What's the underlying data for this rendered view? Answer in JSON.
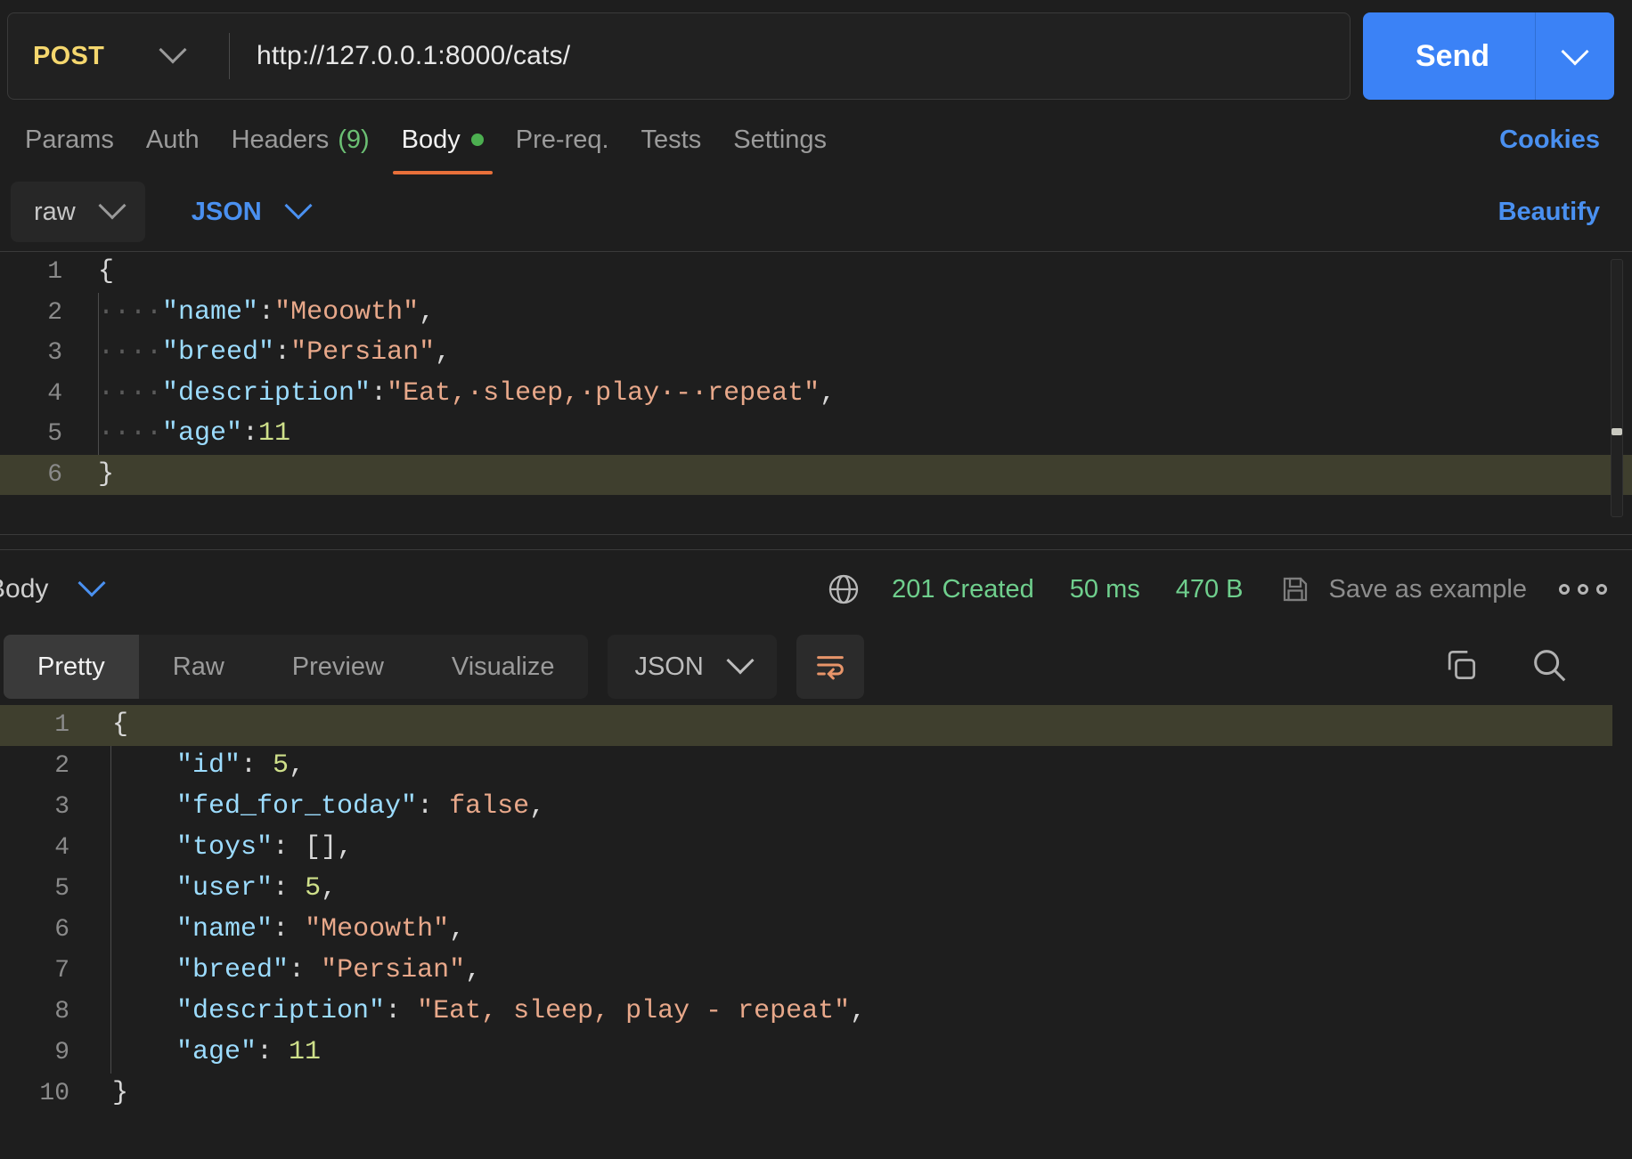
{
  "request": {
    "method": "POST",
    "url": "http://127.0.0.1:8000/cats/",
    "send_label": "Send",
    "tabs": [
      {
        "label": "Params",
        "active": false
      },
      {
        "label": "Auth",
        "active": false
      },
      {
        "label": "Headers",
        "count": "(9)",
        "active": false
      },
      {
        "label": "Body",
        "active": true,
        "dot": true
      },
      {
        "label": "Pre-req.",
        "active": false
      },
      {
        "label": "Tests",
        "active": false
      },
      {
        "label": "Settings",
        "active": false
      }
    ],
    "cookies_label": "Cookies",
    "body_mode": "raw",
    "body_format": "JSON",
    "beautify_label": "Beautify",
    "code_lines": [
      {
        "num": "1",
        "highlight": false,
        "indent": false,
        "tokens": [
          {
            "t": "{",
            "c": "p"
          }
        ]
      },
      {
        "num": "2",
        "highlight": false,
        "indent": true,
        "tokens": [
          {
            "t": "····",
            "c": "dot"
          },
          {
            "t": "\"name\"",
            "c": "k"
          },
          {
            "t": ":",
            "c": "p"
          },
          {
            "t": "\"Meoowth\"",
            "c": "s"
          },
          {
            "t": ",",
            "c": "p"
          }
        ]
      },
      {
        "num": "3",
        "highlight": false,
        "indent": true,
        "tokens": [
          {
            "t": "····",
            "c": "dot"
          },
          {
            "t": "\"breed\"",
            "c": "k"
          },
          {
            "t": ":",
            "c": "p"
          },
          {
            "t": "\"Persian\"",
            "c": "s"
          },
          {
            "t": ",",
            "c": "p"
          }
        ]
      },
      {
        "num": "4",
        "highlight": false,
        "indent": true,
        "tokens": [
          {
            "t": "····",
            "c": "dot"
          },
          {
            "t": "\"description\"",
            "c": "k"
          },
          {
            "t": ":",
            "c": "p"
          },
          {
            "t": "\"Eat,·sleep,·play·-·repeat\"",
            "c": "s"
          },
          {
            "t": ",",
            "c": "p"
          }
        ]
      },
      {
        "num": "5",
        "highlight": false,
        "indent": true,
        "tokens": [
          {
            "t": "····",
            "c": "dot"
          },
          {
            "t": "\"age\"",
            "c": "k"
          },
          {
            "t": ":",
            "c": "p"
          },
          {
            "t": "11",
            "c": "n"
          }
        ]
      },
      {
        "num": "6",
        "highlight": true,
        "indent": false,
        "tokens": [
          {
            "t": "}",
            "c": "p"
          }
        ]
      }
    ]
  },
  "response": {
    "body_label": "Body",
    "status": "201 Created",
    "time": "50 ms",
    "size": "470 B",
    "save_as_example": "Save as example",
    "tabs": [
      {
        "label": "Pretty",
        "active": true
      },
      {
        "label": "Raw",
        "active": false
      },
      {
        "label": "Preview",
        "active": false
      },
      {
        "label": "Visualize",
        "active": false
      }
    ],
    "format": "JSON",
    "code_lines": [
      {
        "num": "1",
        "highlight": true,
        "indent": false,
        "tokens": [
          {
            "t": "{",
            "c": "p"
          }
        ]
      },
      {
        "num": "2",
        "highlight": false,
        "indent": true,
        "tokens": [
          {
            "t": "    ",
            "c": "p"
          },
          {
            "t": "\"id\"",
            "c": "k"
          },
          {
            "t": ": ",
            "c": "p"
          },
          {
            "t": "5",
            "c": "n"
          },
          {
            "t": ",",
            "c": "p"
          }
        ]
      },
      {
        "num": "3",
        "highlight": false,
        "indent": true,
        "tokens": [
          {
            "t": "    ",
            "c": "p"
          },
          {
            "t": "\"fed_for_today\"",
            "c": "k"
          },
          {
            "t": ": ",
            "c": "p"
          },
          {
            "t": "false",
            "c": "s"
          },
          {
            "t": ",",
            "c": "p"
          }
        ]
      },
      {
        "num": "4",
        "highlight": false,
        "indent": true,
        "tokens": [
          {
            "t": "    ",
            "c": "p"
          },
          {
            "t": "\"toys\"",
            "c": "k"
          },
          {
            "t": ": ",
            "c": "p"
          },
          {
            "t": "[]",
            "c": "p"
          },
          {
            "t": ",",
            "c": "p"
          }
        ]
      },
      {
        "num": "5",
        "highlight": false,
        "indent": true,
        "tokens": [
          {
            "t": "    ",
            "c": "p"
          },
          {
            "t": "\"user\"",
            "c": "k"
          },
          {
            "t": ": ",
            "c": "p"
          },
          {
            "t": "5",
            "c": "n"
          },
          {
            "t": ",",
            "c": "p"
          }
        ]
      },
      {
        "num": "6",
        "highlight": false,
        "indent": true,
        "tokens": [
          {
            "t": "    ",
            "c": "p"
          },
          {
            "t": "\"name\"",
            "c": "k"
          },
          {
            "t": ": ",
            "c": "p"
          },
          {
            "t": "\"Meoowth\"",
            "c": "s"
          },
          {
            "t": ",",
            "c": "p"
          }
        ]
      },
      {
        "num": "7",
        "highlight": false,
        "indent": true,
        "tokens": [
          {
            "t": "    ",
            "c": "p"
          },
          {
            "t": "\"breed\"",
            "c": "k"
          },
          {
            "t": ": ",
            "c": "p"
          },
          {
            "t": "\"Persian\"",
            "c": "s"
          },
          {
            "t": ",",
            "c": "p"
          }
        ]
      },
      {
        "num": "8",
        "highlight": false,
        "indent": true,
        "tokens": [
          {
            "t": "    ",
            "c": "p"
          },
          {
            "t": "\"description\"",
            "c": "k"
          },
          {
            "t": ": ",
            "c": "p"
          },
          {
            "t": "\"Eat, sleep, play - repeat\"",
            "c": "s"
          },
          {
            "t": ",",
            "c": "p"
          }
        ]
      },
      {
        "num": "9",
        "highlight": false,
        "indent": true,
        "tokens": [
          {
            "t": "    ",
            "c": "p"
          },
          {
            "t": "\"age\"",
            "c": "k"
          },
          {
            "t": ": ",
            "c": "p"
          },
          {
            "t": "11",
            "c": "n"
          }
        ]
      },
      {
        "num": "10",
        "highlight": false,
        "indent": false,
        "tokens": [
          {
            "t": "}",
            "c": "p"
          }
        ]
      }
    ]
  },
  "colors": {
    "accent_blue": "#3b82f6",
    "method_yellow": "#f5d76e",
    "status_green": "#6fcf8d",
    "active_tab_underline": "#e8703a",
    "wrap_icon": "#e8956a",
    "key": "#9cdcfe",
    "string": "#e8a88a",
    "number": "#cfe08a",
    "highlight_line": "#3f3f2e",
    "background": "#1e1e1e"
  }
}
